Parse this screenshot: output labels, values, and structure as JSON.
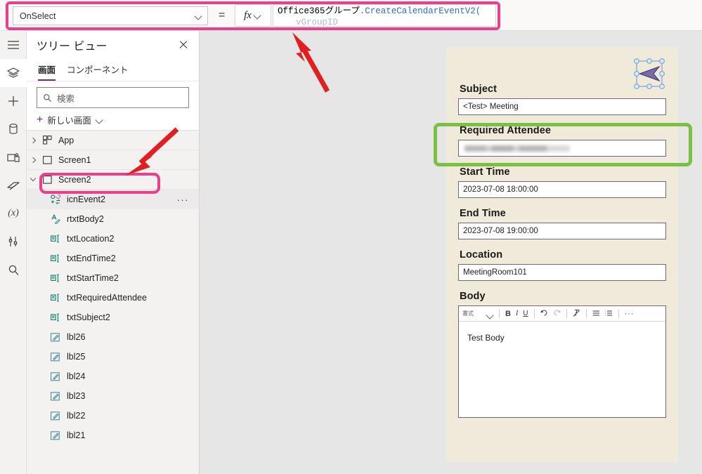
{
  "formula_bar": {
    "property": "OnSelect",
    "equals": "=",
    "fx": "fx",
    "formula_line1_prefix": "Office365グループ",
    "formula_line1_fn": ".CreateCalendarEventV2(",
    "formula_line2": "vGroupID"
  },
  "rail": {
    "items": [
      {
        "name": "hamburger-menu-icon",
        "label": "メニュー"
      },
      {
        "name": "tree-view-icon",
        "label": "ツリー ビュー"
      },
      {
        "name": "insert-icon",
        "label": "挿入"
      },
      {
        "name": "data-icon",
        "label": "データ"
      },
      {
        "name": "media-icon",
        "label": "メディア"
      },
      {
        "name": "power-automate-icon",
        "label": "Power Automate"
      },
      {
        "name": "variables-icon",
        "label": "変数"
      },
      {
        "name": "settings-tools-icon",
        "label": "詳細設定"
      },
      {
        "name": "search-icon",
        "label": "検索"
      }
    ]
  },
  "tree_panel": {
    "title": "ツリー ビュー",
    "close_label": "×",
    "tabs": [
      {
        "label": "画面",
        "selected": true
      },
      {
        "label": "コンポーネント",
        "selected": false
      }
    ],
    "search_placeholder": "検索",
    "new_screen_label": "新しい画面",
    "more_menu": "···",
    "items": [
      {
        "label": "App",
        "icon": "app-icon",
        "indent": 0,
        "caret": "right",
        "selected": false
      },
      {
        "label": "Screen1",
        "icon": "screen-icon",
        "indent": 0,
        "caret": "right",
        "selected": false
      },
      {
        "label": "Screen2",
        "icon": "screen-icon",
        "indent": 0,
        "caret": "down",
        "selected": false
      },
      {
        "label": "icnEvent2",
        "icon": "icon-control-icon",
        "indent": 1,
        "caret": "none",
        "selected": true
      },
      {
        "label": "rtxtBody2",
        "icon": "richtext-icon",
        "indent": 1,
        "caret": "none",
        "selected": false
      },
      {
        "label": "txtLocation2",
        "icon": "textinput-icon",
        "indent": 1,
        "caret": "none",
        "selected": false
      },
      {
        "label": "txtEndTime2",
        "icon": "textinput-icon",
        "indent": 1,
        "caret": "none",
        "selected": false
      },
      {
        "label": "txtStartTime2",
        "icon": "textinput-icon",
        "indent": 1,
        "caret": "none",
        "selected": false
      },
      {
        "label": "txtRequiredAttendee",
        "icon": "textinput-icon",
        "indent": 1,
        "caret": "none",
        "selected": false
      },
      {
        "label": "txtSubject2",
        "icon": "textinput-icon",
        "indent": 1,
        "caret": "none",
        "selected": false
      },
      {
        "label": "lbl26",
        "icon": "label-icon",
        "indent": 1,
        "caret": "none",
        "selected": false
      },
      {
        "label": "lbl25",
        "icon": "label-icon",
        "indent": 1,
        "caret": "none",
        "selected": false
      },
      {
        "label": "lbl24",
        "icon": "label-icon",
        "indent": 1,
        "caret": "none",
        "selected": false
      },
      {
        "label": "lbl23",
        "icon": "label-icon",
        "indent": 1,
        "caret": "none",
        "selected": false
      },
      {
        "label": "lbl22",
        "icon": "label-icon",
        "indent": 1,
        "caret": "none",
        "selected": false
      },
      {
        "label": "lbl21",
        "icon": "label-icon",
        "indent": 1,
        "caret": "none",
        "selected": false
      }
    ]
  },
  "canvas": {
    "send_icon_name": "send-paper-plane-icon",
    "fields": [
      {
        "label": "Subject",
        "value": "<Test> Meeting",
        "blurred": false
      },
      {
        "label": "Required Attendee",
        "value": "",
        "blurred": true
      },
      {
        "label": "Start Time",
        "value": "2023-07-08 18:00:00",
        "blurred": false
      },
      {
        "label": "End Time",
        "value": "2023-07-08 19:00:00",
        "blurred": false
      },
      {
        "label": "Location",
        "value": "MeetingRoom101",
        "blurred": false
      }
    ],
    "body": {
      "label": "Body",
      "text": "Test Body",
      "toolbar": {
        "style_label": "書式",
        "bold": "B",
        "italic": "I",
        "underline": "U",
        "undo": "undo-icon",
        "redo": "redo-icon",
        "clear_format": "clear-format-icon",
        "bullet_list": "bullet-list-icon",
        "numbered_list": "numbered-list-icon",
        "overflow": "···"
      }
    }
  },
  "annotations": {
    "highlight_pink": "#e8408a",
    "highlight_green": "#7cc043",
    "arrow_color": "#e02020",
    "arrow_formula_target": "formula-bar",
    "arrow_tree_target": "icnEvent2"
  }
}
